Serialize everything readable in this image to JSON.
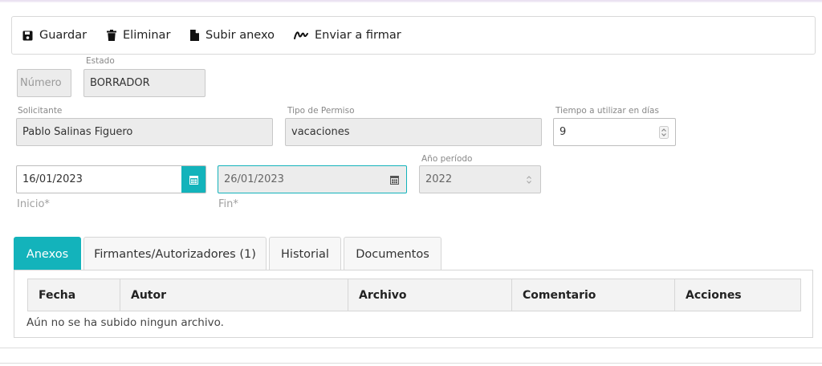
{
  "toolbar": {
    "save_label": "Guardar",
    "delete_label": "Eliminar",
    "upload_label": "Subir anexo",
    "sign_label": "Enviar a firmar"
  },
  "form": {
    "numero_placeholder": "Número",
    "estado_label": "Estado",
    "estado_value": "BORRADOR",
    "solicitante_label": "Solicitante",
    "solicitante_value": "Pablo Salinas Figuero",
    "tipo_label": "Tipo de Permiso",
    "tipo_value": "vacaciones",
    "tiempo_label": "Tiempo a utilizar en días",
    "tiempo_value": "9",
    "inicio_value": "16/01/2023",
    "inicio_label": "Inicio*",
    "fin_value": "26/01/2023",
    "fin_label": "Fin*",
    "anio_label": "Año período",
    "anio_value": "2022"
  },
  "tabs": [
    {
      "label": "Anexos",
      "active": true
    },
    {
      "label": "Firmantes/Autorizadores (1)"
    },
    {
      "label": "Historial"
    },
    {
      "label": "Documentos"
    }
  ],
  "table": {
    "columns": [
      "Fecha",
      "Autor",
      "Archivo",
      "Comentario",
      "Acciones"
    ],
    "empty_message": "Aún no se ha subido ningun archivo."
  },
  "colors": {
    "accent": "#13b3bb"
  },
  "icons": [
    "save-icon",
    "trash-icon",
    "file-icon",
    "signature-icon",
    "calendar-icon",
    "spinner-arrows-icon"
  ]
}
